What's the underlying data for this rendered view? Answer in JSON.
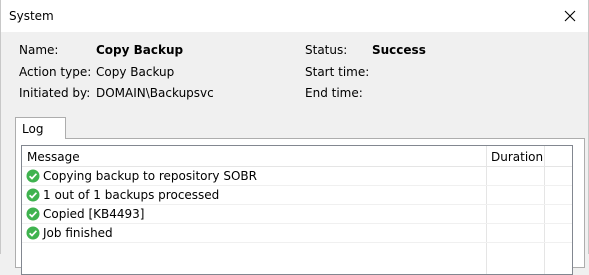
{
  "window": {
    "title": "System"
  },
  "info": {
    "name_label": "Name:",
    "name_value": "Copy Backup",
    "action_type_label": "Action type:",
    "action_type_value": "Copy Backup",
    "initiated_by_label": "Initiated by:",
    "initiated_by_value": "DOMAIN\\Backupsvc",
    "status_label": "Status:",
    "status_value": "Success",
    "start_time_label": "Start time:",
    "end_time_label": "End time:"
  },
  "tabs": [
    {
      "label": "Log"
    }
  ],
  "log": {
    "columns": [
      "Message",
      "Duration"
    ],
    "rows": [
      {
        "message": "Copying backup to repository SOBR",
        "duration": "",
        "status_icon": "check-circle-icon"
      },
      {
        "message": "1 out of 1 backups processed",
        "duration": "",
        "status_icon": "check-circle-icon"
      },
      {
        "message": "Copied [KB4493]",
        "duration": "",
        "status_icon": "check-circle-icon"
      },
      {
        "message": "Job finished",
        "duration": "",
        "status_icon": "check-circle-icon"
      }
    ]
  },
  "colors": {
    "success_green": "#3fb34f"
  }
}
